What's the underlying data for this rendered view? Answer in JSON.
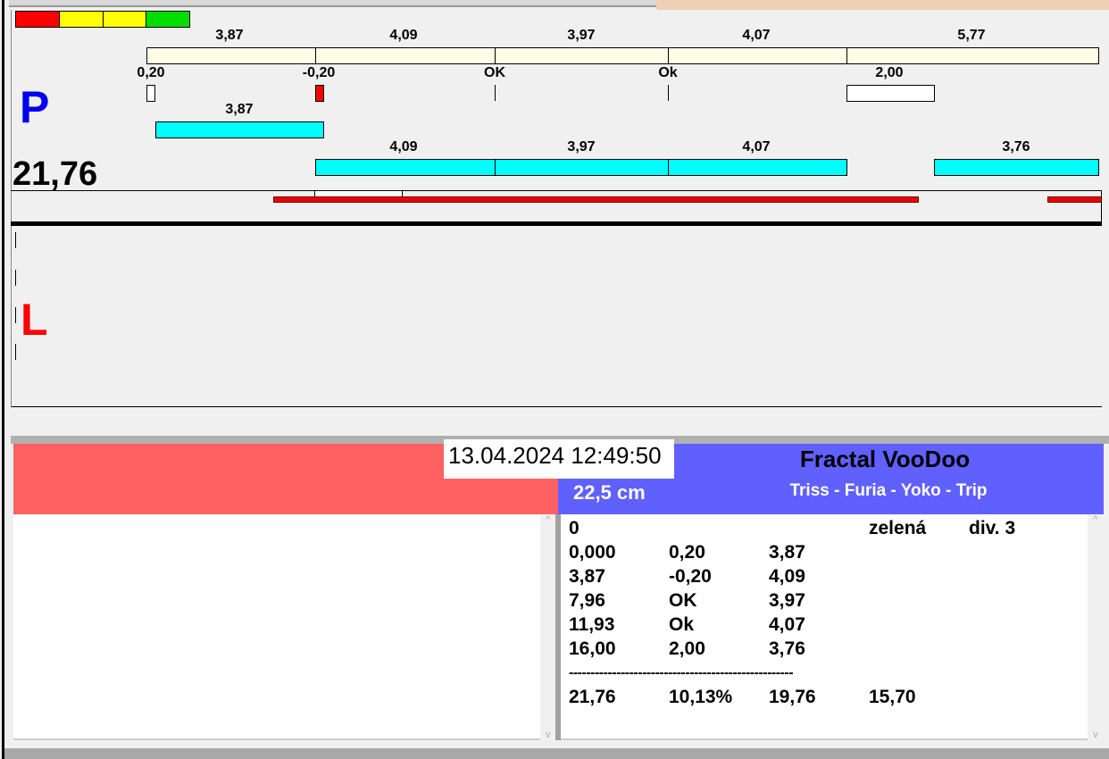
{
  "colors": {
    "red": "#ff0000",
    "yellow": "#ffff00",
    "green": "#00dd00",
    "cyan": "#00ffff",
    "blue_panel": "#6060ff",
    "red_panel": "#ff6060",
    "p_label": "#0000ee",
    "l_label": "#ff0000"
  },
  "top_chart": {
    "side_p": "P",
    "side_l": "L",
    "total": "21,76",
    "segment_labels": [
      "3,87",
      "4,09",
      "3,97",
      "4,07",
      "5,77"
    ],
    "tick_labels": [
      "0,20",
      "-0,20",
      "OK",
      "Ok",
      "2,00"
    ],
    "cyan_row1_labels": [
      "3,87"
    ],
    "cyan_row2_labels": [
      "4,09",
      "3,97",
      "4,07",
      "3,76"
    ]
  },
  "info": {
    "datetime": "13.04.2024 12:49:50",
    "title": "Fractal VooDoo",
    "length": "22,5 cm",
    "names": "Triss - Furia - Yoko - Trip"
  },
  "list": {
    "header": [
      "0",
      "",
      "",
      "zelená",
      "div. 3"
    ],
    "rows": [
      [
        "0,000",
        "0,20",
        "3,87"
      ],
      [
        "3,87",
        "-0,20",
        "4,09"
      ],
      [
        "7,96",
        "OK",
        "3,97"
      ],
      [
        "11,93",
        "Ok",
        "4,07"
      ],
      [
        "16,00",
        "2,00",
        "3,76"
      ]
    ],
    "separator": "----------------------------------------------------",
    "summary": [
      "21,76",
      "10,13%",
      "19,76",
      "15,70"
    ]
  }
}
